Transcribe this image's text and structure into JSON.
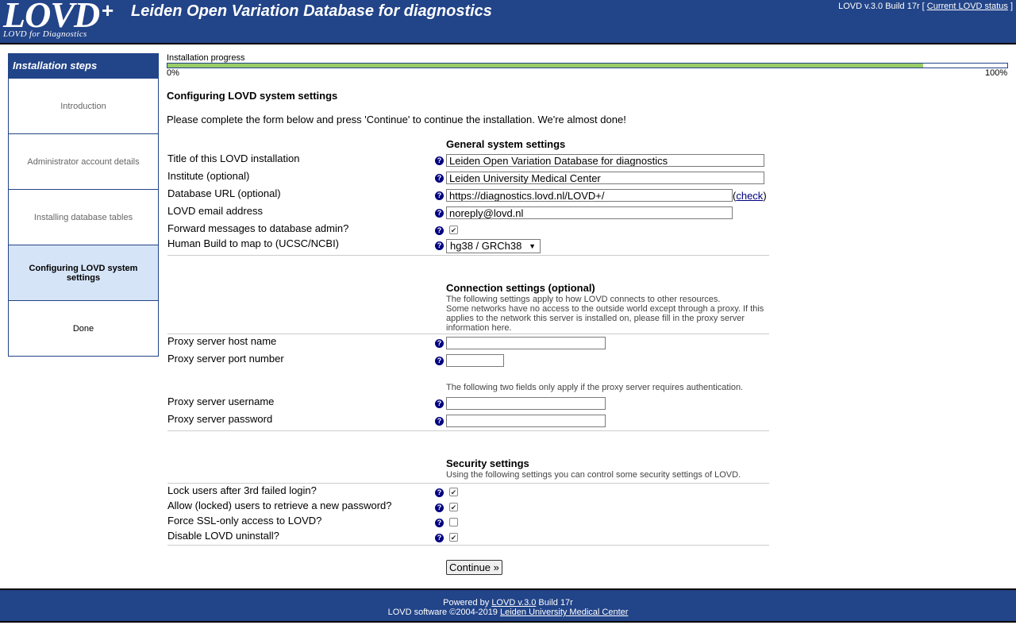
{
  "header": {
    "logo_big": "LOVD",
    "logo_plus": "+",
    "logo_small": "LOVD for Diagnostics",
    "title": "Leiden Open Variation Database for diagnostics",
    "version_prefix": "LOVD v.3.0 Build 17r [",
    "status_link": "Current LOVD status",
    "version_suffix": "]"
  },
  "steps": {
    "heading": "Installation steps",
    "items": [
      {
        "label": "Introduction",
        "state": "done"
      },
      {
        "label": "Administrator account details",
        "state": "done"
      },
      {
        "label": "Installing database tables",
        "state": "done"
      },
      {
        "label": "Configuring LOVD system settings",
        "state": "current"
      },
      {
        "label": "Done",
        "state": "future"
      }
    ]
  },
  "progress": {
    "label": "Installation progress",
    "min_label": "0%",
    "max_label": "100%",
    "fraction": 0.9,
    "fill_color": "#99cc66"
  },
  "main": {
    "title": "Configuring LOVD system settings",
    "intro": "Please complete the form below and press 'Continue' to continue the installation. We're almost done!"
  },
  "general": {
    "heading": "General system settings",
    "title_label": "Title of this LOVD installation",
    "title_value": "Leiden Open Variation Database for diagnostics",
    "institute_label": "Institute (optional)",
    "institute_value": "Leiden University Medical Center",
    "url_label": "Database URL (optional)",
    "url_value": "https://diagnostics.lovd.nl/LOVD+/",
    "check_open": "(",
    "check_link": "check",
    "check_close": ")",
    "email_label": "LOVD email address",
    "email_value": "noreply@lovd.nl",
    "forward_label": "Forward messages to database admin?",
    "forward_checked": true,
    "build_label": "Human Build to map to (UCSC/NCBI)",
    "build_value": "hg38 / GRCh38"
  },
  "connection": {
    "heading": "Connection settings (optional)",
    "note1": "The following settings apply to how LOVD connects to other resources.",
    "note2": "Some networks have no access to the outside world except through a proxy. If this applies to the network this server is installed on, please fill in the proxy server information here.",
    "host_label": "Proxy server host name",
    "host_value": "",
    "port_label": "Proxy server port number",
    "port_value": "",
    "auth_note": "The following two fields only apply if the proxy server requires authentication.",
    "user_label": "Proxy server username",
    "user_value": "",
    "pass_label": "Proxy server password",
    "pass_value": ""
  },
  "security": {
    "heading": "Security settings",
    "note": "Using the following settings you can control some security settings of LOVD.",
    "lock_label": "Lock users after 3rd failed login?",
    "lock_checked": true,
    "retrieve_label": "Allow (locked) users to retrieve a new password?",
    "retrieve_checked": true,
    "ssl_label": "Force SSL-only access to LOVD?",
    "ssl_checked": false,
    "uninstall_label": "Disable LOVD uninstall?",
    "uninstall_checked": true
  },
  "help_icon": "?",
  "check_glyph": "✔",
  "continue_label": "Continue »",
  "footer": {
    "powered_prefix": "Powered by",
    "powered_link": "LOVD v.3.0",
    "powered_suffix": "Build 17r",
    "copyright": "LOVD software ©2004-2019",
    "copyright_link": "Leiden University Medical Center"
  }
}
